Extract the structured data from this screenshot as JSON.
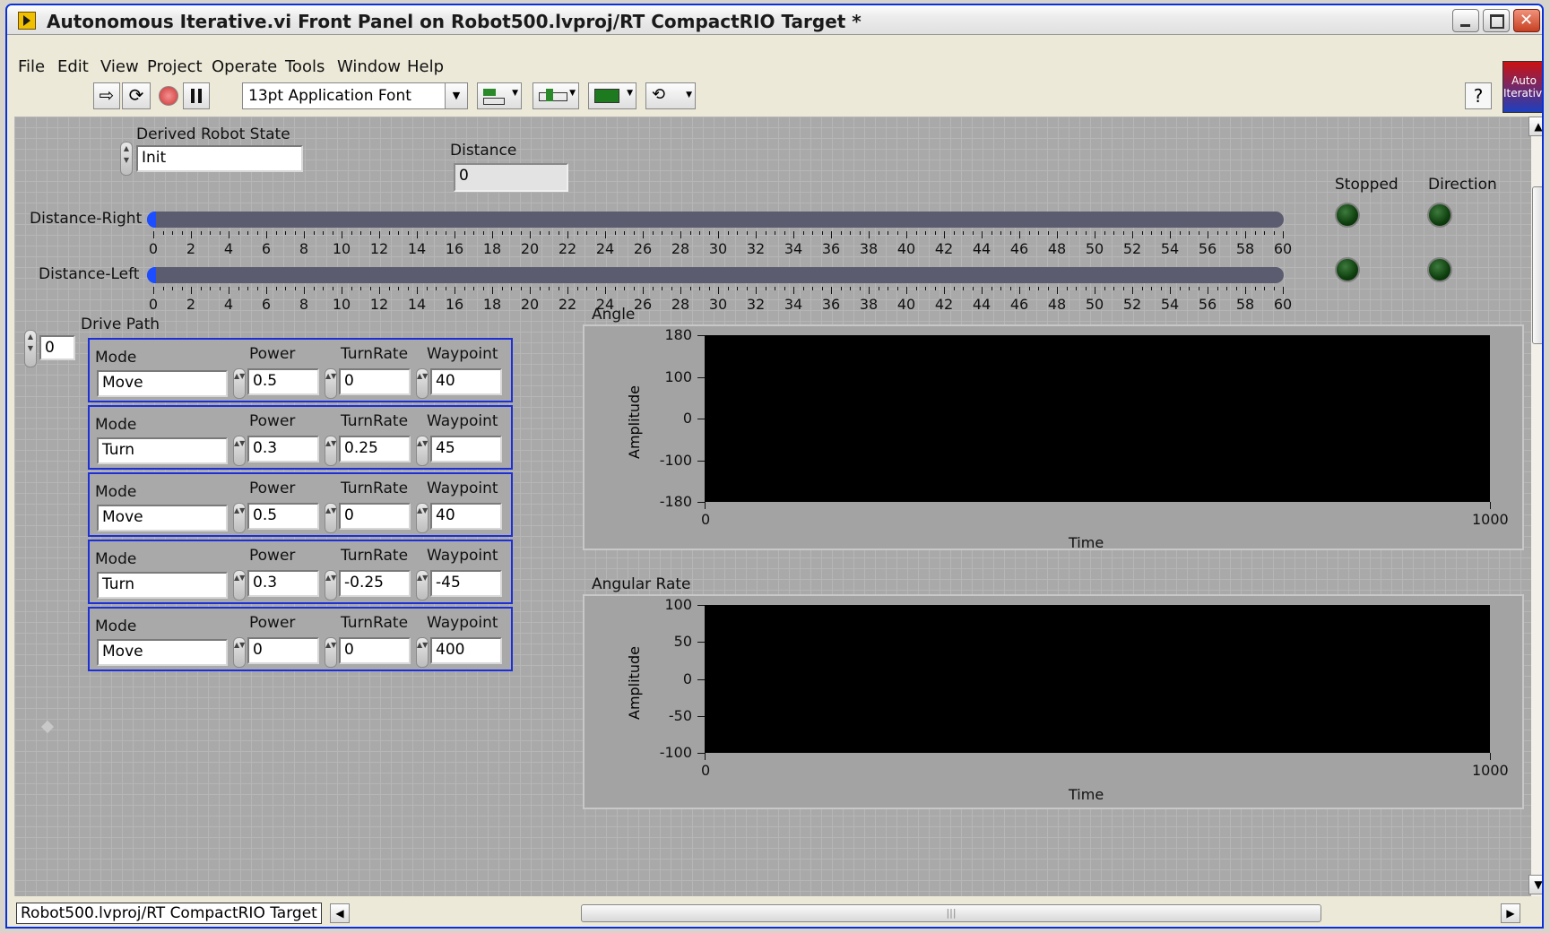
{
  "window": {
    "title": "Autonomous Iterative.vi Front Panel on Robot500.lvproj/RT CompactRIO Target *",
    "icon_label": "Auto Iterative"
  },
  "menu": [
    "File",
    "Edit",
    "View",
    "Project",
    "Operate",
    "Tools",
    "Window",
    "Help"
  ],
  "toolbar": {
    "font": "13pt Application Font",
    "help": "?"
  },
  "panel": {
    "derived_robot_state": {
      "label": "Derived Robot State",
      "value": "Init"
    },
    "distance": {
      "label": "Distance",
      "value": "0"
    },
    "distance_right": {
      "label": "Distance-Right",
      "value": 0,
      "min": 0,
      "max": 60
    },
    "distance_left": {
      "label": "Distance-Left",
      "value": 0,
      "min": 0,
      "max": 60
    },
    "scale_labels": [
      "0",
      "2",
      "4",
      "6",
      "8",
      "10",
      "12",
      "14",
      "16",
      "18",
      "20",
      "22",
      "24",
      "26",
      "28",
      "30",
      "32",
      "34",
      "36",
      "38",
      "40",
      "42",
      "44",
      "46",
      "48",
      "50",
      "52",
      "54",
      "56",
      "58",
      "60"
    ],
    "stopped_label": "Stopped",
    "direction_label": "Direction",
    "drive_path": {
      "label": "Drive Path",
      "index": "0",
      "col_mode": "Mode",
      "col_power": "Power",
      "col_turnrate": "TurnRate",
      "col_waypoint": "Waypoint",
      "rows": [
        {
          "mode": "Move",
          "power": "0.5",
          "turnrate": "0",
          "waypoint": "40"
        },
        {
          "mode": "Turn",
          "power": "0.3",
          "turnrate": "0.25",
          "waypoint": "45"
        },
        {
          "mode": "Move",
          "power": "0.5",
          "turnrate": "0",
          "waypoint": "40"
        },
        {
          "mode": "Turn",
          "power": "0.3",
          "turnrate": "-0.25",
          "waypoint": "-45"
        },
        {
          "mode": "Move",
          "power": "0",
          "turnrate": "0",
          "waypoint": "400"
        }
      ]
    },
    "angle_chart": {
      "label": "Angle",
      "ylabel": "Amplitude",
      "xlabel": "Time",
      "yticks": [
        "180",
        "100",
        "0",
        "-100",
        "-180"
      ],
      "xticks": [
        "0",
        "1000"
      ]
    },
    "rate_chart": {
      "label": "Angular Rate",
      "ylabel": "Amplitude",
      "xlabel": "Time",
      "yticks": [
        "100",
        "50",
        "0",
        "-50",
        "-100"
      ],
      "xticks": [
        "0",
        "1000"
      ]
    }
  },
  "status": {
    "target": "Robot500.lvproj/RT CompactRIO Target"
  }
}
